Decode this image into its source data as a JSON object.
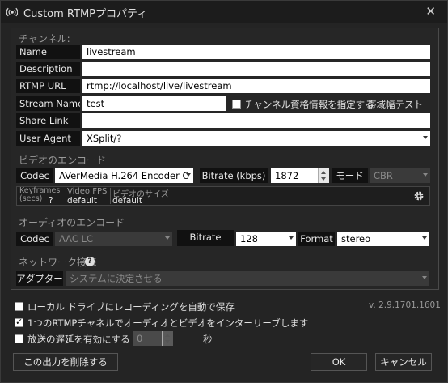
{
  "window": {
    "title": "Custom RTMPプロパティ",
    "close_glyph": "✕"
  },
  "channel": {
    "section_title": "チャンネル:",
    "name_label": "Name",
    "name_value": "livestream",
    "description_label": "Description",
    "description_value": "",
    "rtmp_url_label": "RTMP URL",
    "rtmp_url_value": "rtmp://localhost/live/livestream",
    "stream_name_label": "Stream Name",
    "stream_name_value": "test",
    "specify_credentials_label": "チャンネル資格情報を指定する",
    "specify_credentials_checked": false,
    "bandwidth_test_label": "帯域幅テスト",
    "share_link_label": "Share Link",
    "share_link_value": "",
    "user_agent_label": "User Agent",
    "user_agent_value": "XSplit/?"
  },
  "video": {
    "section_title": "ビデオのエンコード",
    "codec_label": "Codec",
    "codec_value": "AVerMedia H.264 Encoder C",
    "bitrate_label": "Bitrate (kbps)",
    "bitrate_value": "1872",
    "mode_label": "モード",
    "mode_value": "CBR",
    "keyframes_label": "Keyframes (secs)",
    "keyframes_value": "?",
    "fps_label": "Video FPS",
    "fps_value": "default",
    "size_label": "ビデオのサイズ",
    "size_value": "default"
  },
  "audio": {
    "section_title": "オーディオのエンコード",
    "codec_label": "Codec",
    "codec_value": "AAC LC",
    "bitrate_label": "Bitrate",
    "bitrate_value": "128",
    "format_label": "Format",
    "format_value": "stereo"
  },
  "network": {
    "section_title": "ネットワーク接続",
    "help_glyph": "?",
    "adapter_label": "アダプター",
    "adapter_value": "システムに決定させる"
  },
  "options": {
    "auto_record_label": "ローカル ドライブにレコーディングを自動で保存",
    "auto_record_checked": false,
    "interleave_label": "1つのRTMPチャネルでオーディオとビデオをインターリーブします",
    "interleave_checked": true,
    "delay_label": "放送の遅延を有効にする",
    "delay_checked": false,
    "delay_value": "0",
    "delay_unit": "秒",
    "version": "v. 2.9.1701.1601"
  },
  "buttons": {
    "delete_output": "この出力を削除する",
    "ok": "OK",
    "cancel": "キャンセル"
  },
  "colors": {
    "background": "#242424",
    "label_bg": "#111111",
    "field_bg": "#ffffff"
  }
}
